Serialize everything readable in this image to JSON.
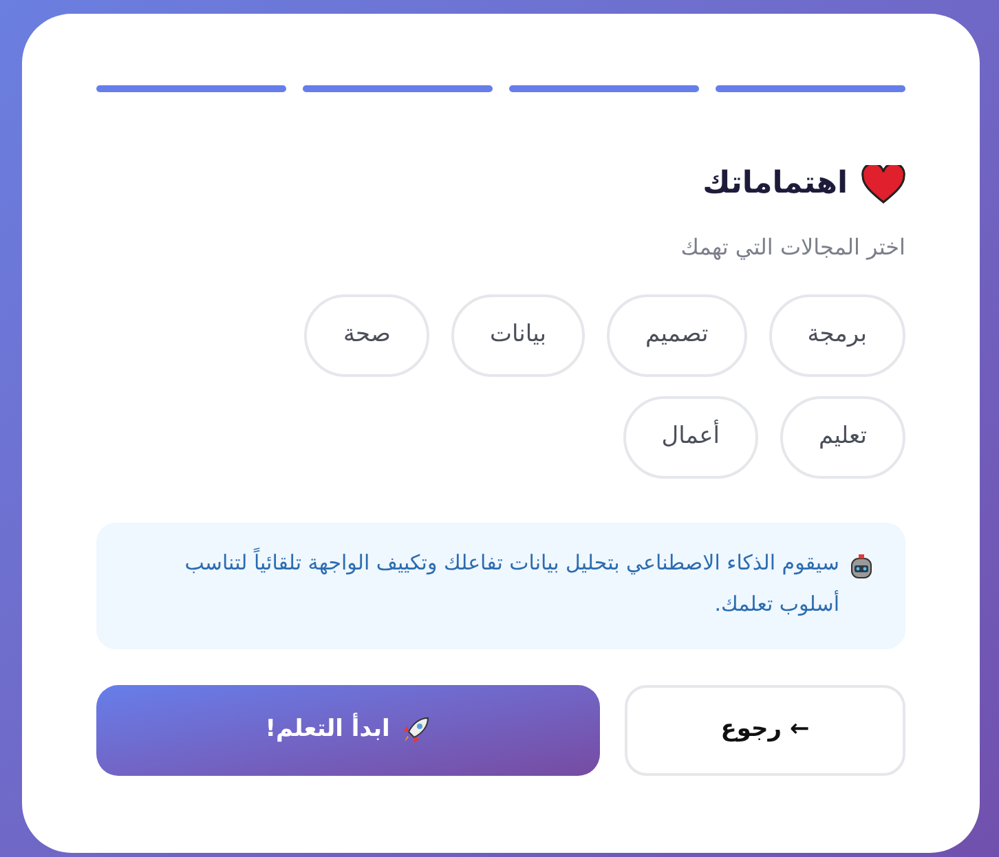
{
  "progress": [
    {
      "filled": true
    },
    {
      "filled": true
    },
    {
      "filled": true
    },
    {
      "filled": true
    }
  ],
  "title": "اهتماماتك",
  "subtitle": "اختر المجالات التي تهمك",
  "interests": [
    {
      "label": "برمجة",
      "selected": false
    },
    {
      "label": "تصميم",
      "selected": false
    },
    {
      "label": "بيانات",
      "selected": false
    },
    {
      "label": "صحة",
      "selected": false
    },
    {
      "label": "تعليم",
      "selected": false
    },
    {
      "label": "أعمال",
      "selected": false
    }
  ],
  "info": "سيقوم الذكاء الاصطناعي بتحليل بيانات تفاعلك وتكييف الواجهة تلقائياً لتناسب أسلوب تعلمك.",
  "buttons": {
    "back": "← رجوع",
    "start": "ابدأ التعلم!"
  }
}
